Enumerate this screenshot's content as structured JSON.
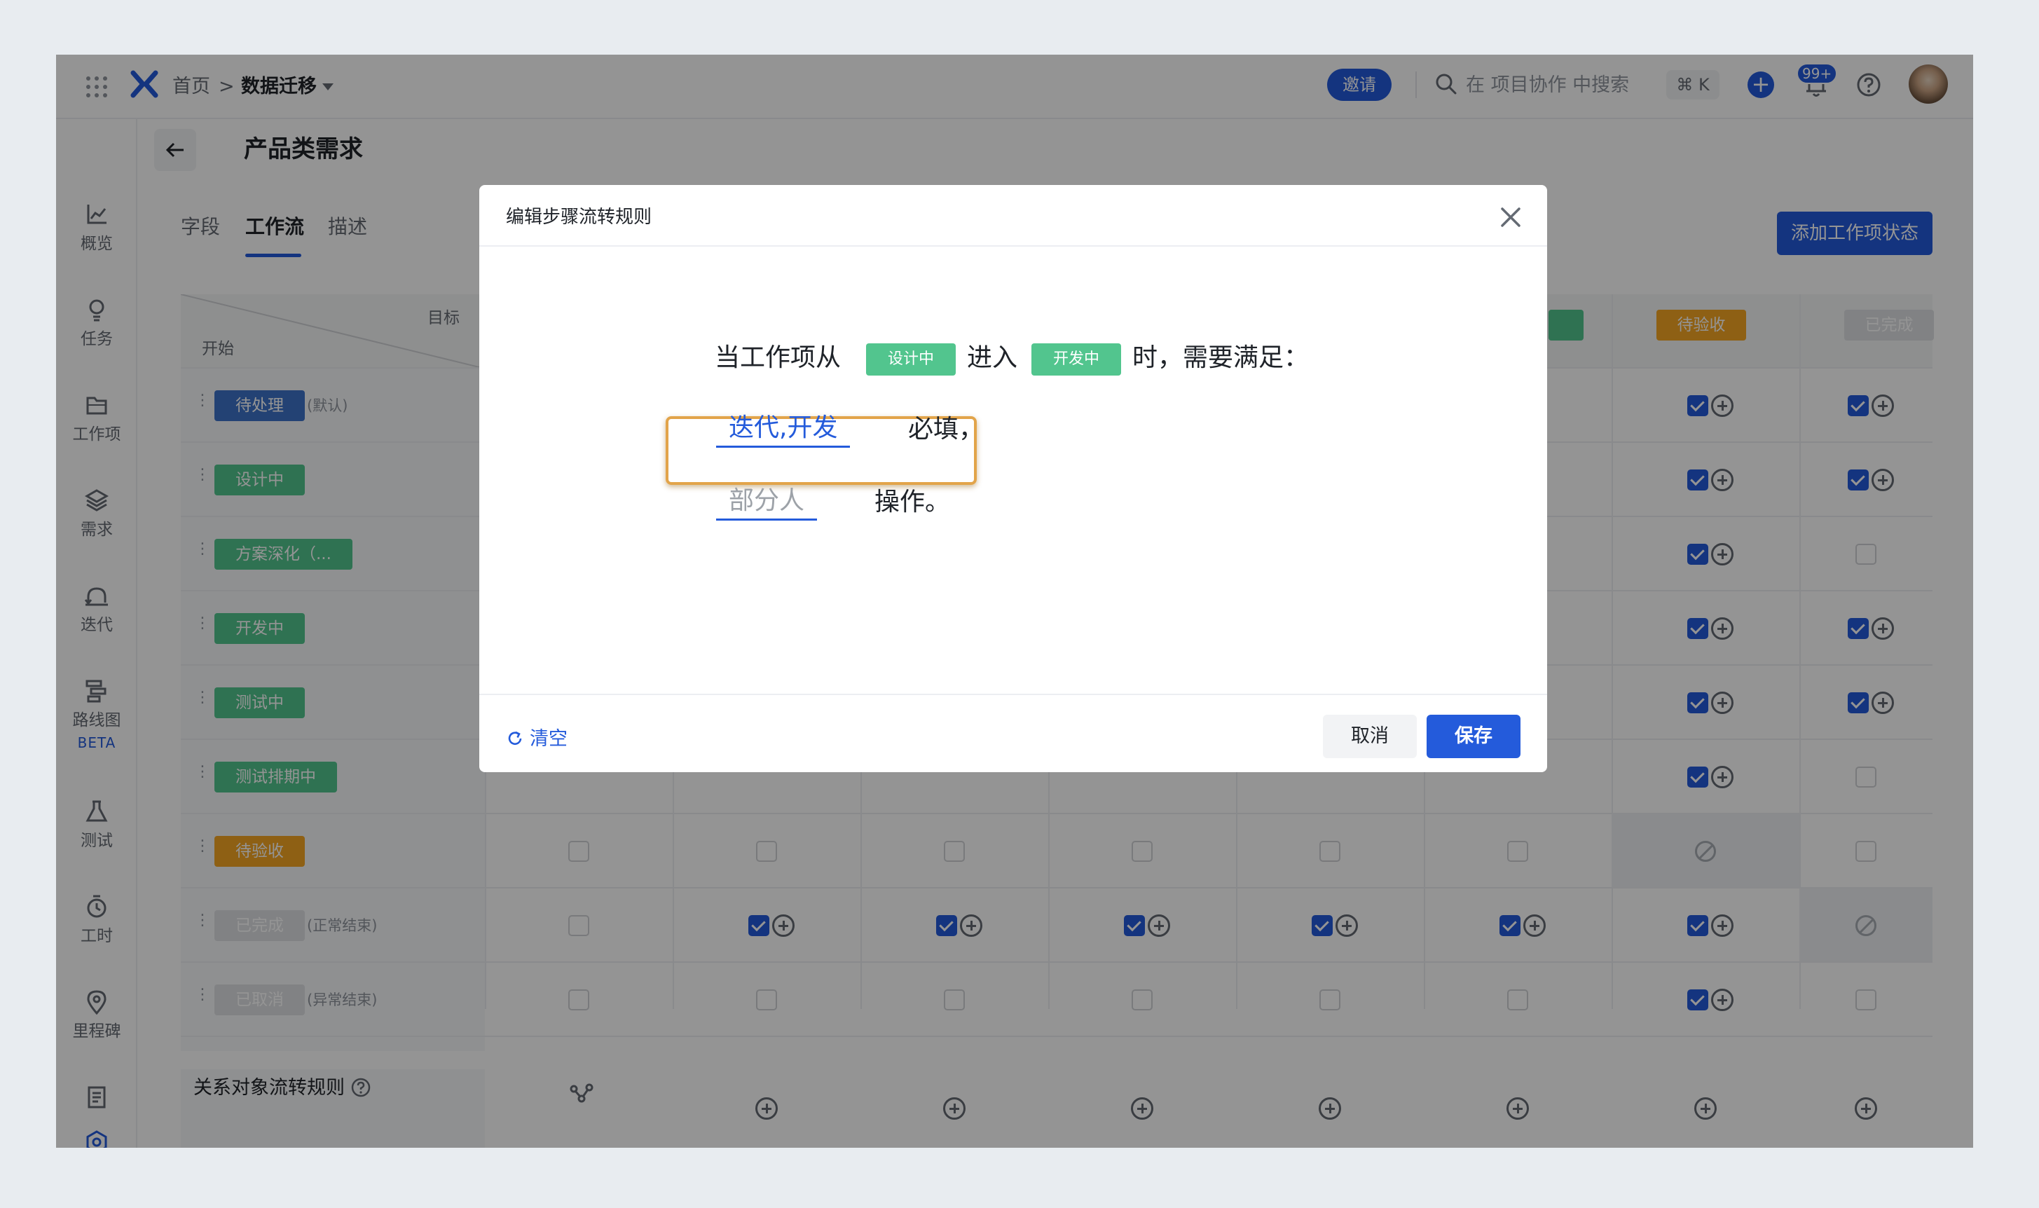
{
  "header": {
    "breadcrumb_home": "首页",
    "breadcrumb_sep": ">",
    "project": "数据迁移",
    "invite": "邀请",
    "search_placeholder": "在 项目协作 中搜索",
    "shortcut": "⌘ K",
    "notif_badge": "99+"
  },
  "sidebar": {
    "items": [
      {
        "label": "概览",
        "icon": "chart-line-icon"
      },
      {
        "label": "任务",
        "icon": "lightbulb-icon"
      },
      {
        "label": "工作项",
        "icon": "folder-icon"
      },
      {
        "label": "需求",
        "icon": "layers-icon"
      },
      {
        "label": "迭代",
        "icon": "cycle-icon"
      },
      {
        "label": "路线图",
        "icon": "roadmap-icon",
        "tag": "BETA"
      },
      {
        "label": "测试",
        "icon": "flask-icon"
      },
      {
        "label": "工时",
        "icon": "timer-icon"
      },
      {
        "label": "里程碑",
        "icon": "pin-icon"
      },
      {
        "label": "",
        "icon": "doc-icon"
      },
      {
        "label": "设置",
        "icon": "settings-icon",
        "active": true
      }
    ]
  },
  "page": {
    "title": "产品类需求",
    "tabs": [
      "字段",
      "工作流",
      "描述"
    ],
    "active_tab": "工作流",
    "add_state_button": "添加工作项状态"
  },
  "table": {
    "corner_target": "目标",
    "corner_start": "开始",
    "column_headers": [
      "待验收",
      "已完成"
    ],
    "rows": [
      {
        "state": "待处理",
        "note": "(默认)",
        "color": "#3d72c8"
      },
      {
        "state": "设计中",
        "note": "",
        "color": "#52c58e"
      },
      {
        "state": "方案深化（...",
        "note": "",
        "color": "#52c58e"
      },
      {
        "state": "开发中",
        "note": "",
        "color": "#52c58e"
      },
      {
        "state": "测试中",
        "note": "",
        "color": "#52c58e"
      },
      {
        "state": "测试排期中",
        "note": "",
        "color": "#52c58e"
      },
      {
        "state": "待验收",
        "note": "",
        "color": "#f5a623"
      },
      {
        "state": "已完成",
        "note": "(正常结束)",
        "color": "#dee0e3"
      },
      {
        "state": "已取消",
        "note": "(异常结束)",
        "color": "#dee0e3"
      }
    ],
    "relation_rule_label": "关系对象流转规则"
  },
  "modal": {
    "title": "编辑步骤流转规则",
    "sentence_prefix": "当工作项从",
    "from_state": "设计中",
    "enter_word": "进入",
    "to_state": "开发中",
    "sentence_suffix": "时，需要满足：",
    "required_fields": "迭代,开发",
    "required_suffix": "必填，",
    "operators": "部分人",
    "operators_suffix": "操作。",
    "reset": "清空",
    "cancel": "取消",
    "save": "保存"
  },
  "colors": {
    "primary": "#245bdb",
    "green": "#52c58e",
    "orange": "#f5a623",
    "highlight": "#e2a44a"
  }
}
